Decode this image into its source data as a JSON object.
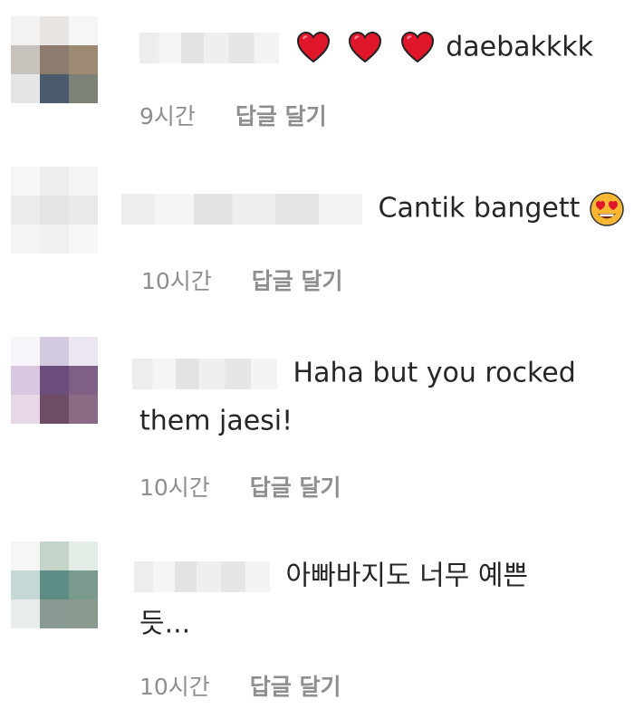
{
  "comments": [
    {
      "text": "daebakkkk",
      "emoji_prefix": [
        "red-heart",
        "red-heart",
        "red-heart"
      ],
      "time": "9시간",
      "reply_label": "답글 달기"
    },
    {
      "text": "Cantik bangett",
      "emoji_suffix": [
        "heart-eyes-face"
      ],
      "time": "10시간",
      "reply_label": "답글 달기"
    },
    {
      "text_line1": "Haha but you rocked",
      "text_line2": "them jaesi!",
      "time": "10시간",
      "reply_label": "답글 달기"
    },
    {
      "text_line1": "아빠바지도 너무 예쁜",
      "text_line2": "듯...",
      "time": "10시간",
      "reply_label": "답글 달기"
    }
  ],
  "colors": {
    "meta_text": "#8e8e8e",
    "comment_text": "#262626",
    "heart_red": "#e0162b"
  }
}
